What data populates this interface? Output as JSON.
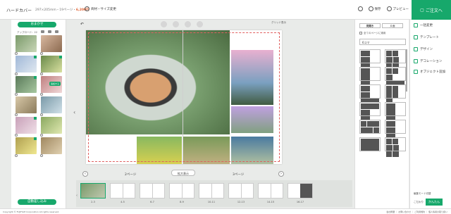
{
  "header": {
    "brand": "ハードカバー",
    "meta_text": "297×205mm・19ページ・",
    "price": "6,200円",
    "change_label": "商材・サイズ変更",
    "help_label": "?",
    "save_label": "保存",
    "preview_label": "プレビュー",
    "order_label": "ご注文へ"
  },
  "left": {
    "auto_label": "おまかせ",
    "upload_label": "アップロード：22",
    "add_tag": "追加する",
    "batch_label": "自動差し込み"
  },
  "canvas": {
    "grid_label": "グリッド表示",
    "left_page_label": "2ページ",
    "right_page_label": "3ページ",
    "expand_label": "拡大表示"
  },
  "strip": {
    "spreads": [
      "2-3",
      "4-5",
      "6-7",
      "8-9",
      "10-11",
      "12-13",
      "14-15",
      "16-17"
    ]
  },
  "right": {
    "tab1": "見開き",
    "tab2": "片面",
    "checkbox_label": "全てのページに適用",
    "select_value": "6コマ"
  },
  "menu": {
    "items": [
      "一括変更",
      "テンプレート",
      "デザイン",
      "デコレーション",
      "オブジェクト追加"
    ],
    "edit_mode": "編集モード切替",
    "current_mode": "こだわり",
    "easy_label": "かんたん"
  },
  "footer": {
    "copyright": "Copyright © FUJIFILM Corporation All rights reserved.",
    "links": "会社概要 ｜ お問い合わせ ｜ ご利用規約 ｜ 個人情報の取り扱い"
  },
  "colors": {
    "accent": "#17a86b",
    "price": "#e06030"
  }
}
